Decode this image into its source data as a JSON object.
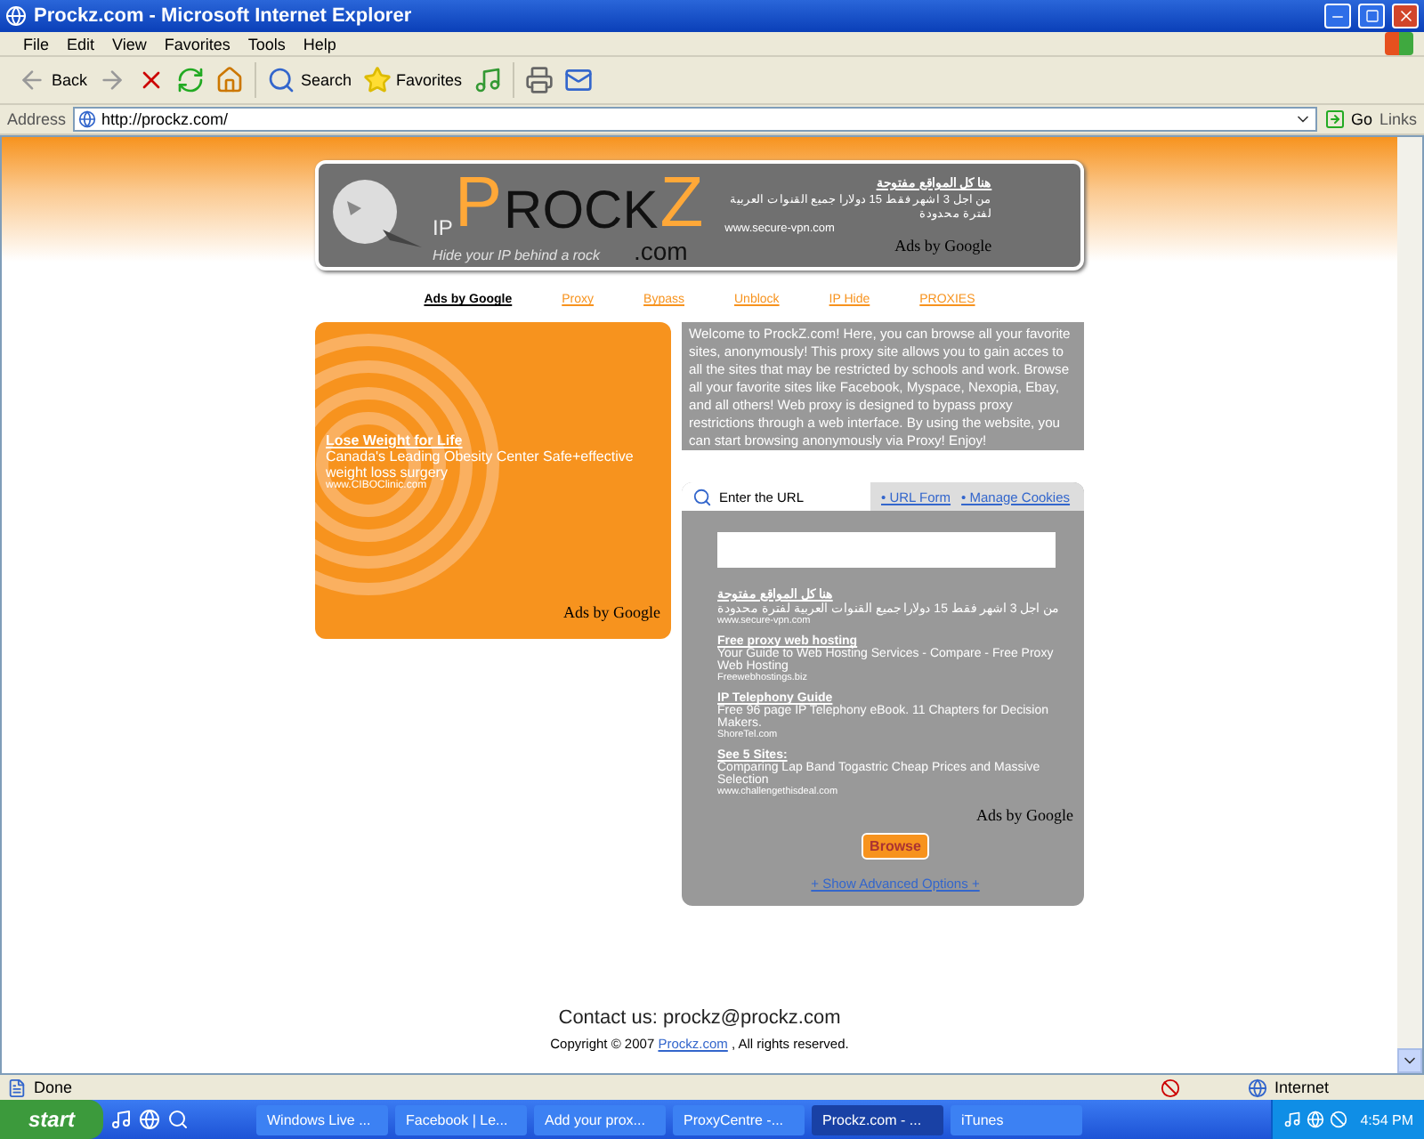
{
  "window": {
    "title": "Prockz.com - Microsoft Internet Explorer"
  },
  "menu": [
    "File",
    "Edit",
    "View",
    "Favorites",
    "Tools",
    "Help"
  ],
  "toolbar": {
    "back": "Back",
    "search": "Search",
    "favorites": "Favorites"
  },
  "address": {
    "label": "Address",
    "value": "http://prockz.com/",
    "go": "Go",
    "links": "Links"
  },
  "banner": {
    "prefix": "IP",
    "letters": [
      "P",
      "ROCK",
      "Z"
    ],
    "tagline": "Hide your IP behind a rock",
    "suffix": ".com",
    "ad_title": "هنا كل المواقع مفتوحة",
    "ad_text": "من اجل 3 اشهر فقط 15 دولارا جميع القنوات العربية لفترة محدودة",
    "ad_url": "www.secure-vpn.com",
    "ads_by": "Ads by Google"
  },
  "nav": [
    {
      "label": "Ads by Google",
      "kind": "heading"
    },
    {
      "label": "Proxy",
      "kind": "link"
    },
    {
      "label": "Bypass",
      "kind": "link"
    },
    {
      "label": "Unblock",
      "kind": "link"
    },
    {
      "label": "IP Hide",
      "kind": "link"
    },
    {
      "label": "PROXIES",
      "kind": "link"
    }
  ],
  "side_ad": {
    "title": "Lose Weight for Life",
    "text": "Canada's Leading Obesity Center Safe+effective weight loss surgery",
    "url": "www.CIBOClinic.com",
    "ads_by": "Ads by Google"
  },
  "intro": "Welcome to ProckZ.com! Here, you can browse all your favorite sites, anonymously! This proxy site allows you to gain acces to all the sites that may be restricted by schools and work. Browse all your favorite sites like Facebook, Myspace, Nexopia, Ebay, and all others! Web proxy is designed to bypass proxy restrictions through a web interface. By using the website, you can start browsing anonymously via Proxy! Enjoy!",
  "url_panel": {
    "heading": "Enter the URL",
    "tabs": [
      {
        "label": "• URL Form"
      },
      {
        "label": "• Manage Cookies"
      }
    ],
    "ads": [
      {
        "title": "هنا كل المواقع مفتوحة",
        "text": "من اجل 3 اشهر فقط 15 دولارا جميع القنوات العربية لفترة محدودة",
        "url": "www.secure-vpn.com"
      },
      {
        "title": "Free proxy web hosting",
        "text": "Your Guide to Web Hosting Services - Compare - Free Proxy Web Hosting",
        "url": "Freewebhostings.biz"
      },
      {
        "title": "IP Telephony Guide",
        "text": "Free 96 page IP Telephony eBook. 11 Chapters for Decision Makers.",
        "url": "ShoreTel.com"
      },
      {
        "title": "See 5 Sites:",
        "text": "Comparing Lap Band Togastric Cheap Prices and Massive Selection",
        "url": "www.challengethisdeal.com"
      }
    ],
    "ads_by": "Ads by Google",
    "button": "Browse",
    "advanced": "+ Show Advanced Options +"
  },
  "footer": {
    "contact": "Contact us: prockz@prockz.com",
    "copyright_before": "Copyright © 2007",
    "copyright_link": "Prockz.com",
    "copyright_after": ", All rights reserved."
  },
  "status_bar": {
    "text": "Done",
    "zone": "Internet"
  },
  "taskbar": {
    "start": "start",
    "tasks": [
      {
        "label": "Windows Live ...",
        "selected": false
      },
      {
        "label": "Facebook | Le...",
        "selected": false
      },
      {
        "label": "Add your prox...",
        "selected": false
      },
      {
        "label": "ProxyCentre -...",
        "selected": false
      },
      {
        "label": "Prockz.com - ...",
        "selected": true
      },
      {
        "label": "iTunes",
        "selected": false
      }
    ],
    "clock": "4:54 PM"
  }
}
